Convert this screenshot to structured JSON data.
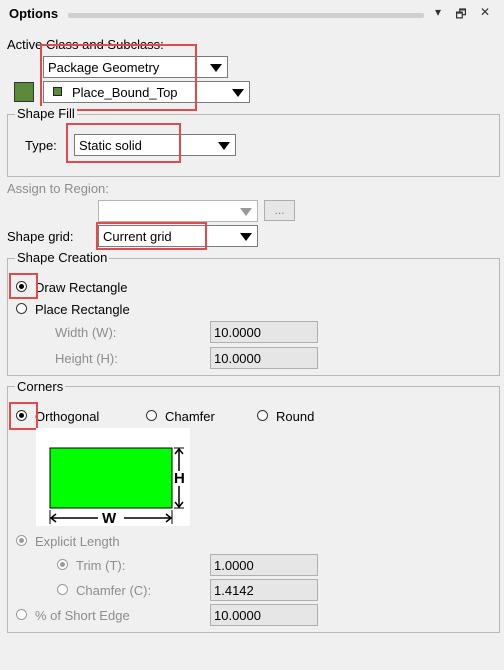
{
  "window": {
    "title": "Options",
    "controls": {
      "close": "✕",
      "restore": "🗗",
      "pin": "▾"
    }
  },
  "active_class": {
    "label": "Active Class and Subclass:",
    "class_value": "Package Geometry",
    "subclass_value": "Place_Bound_Top",
    "color_swatch": "#5b8a3a"
  },
  "shape_fill": {
    "group_title": "Shape Fill",
    "type_label": "Type:",
    "type_value": "Static solid"
  },
  "assign_region": {
    "label": "Assign to Region:",
    "value": "",
    "browse_label": "..."
  },
  "shape_grid": {
    "label": "Shape grid:",
    "value": "Current grid"
  },
  "shape_creation": {
    "group_title": "Shape Creation",
    "draw_rect": "Draw Rectangle",
    "place_rect": "Place Rectangle",
    "width_label": "Width (W):",
    "width_value": "10.0000",
    "height_label": "Height (H):",
    "height_value": "10.0000"
  },
  "corners": {
    "group_title": "Corners",
    "orthogonal": "Orthogonal",
    "chamfer": "Chamfer",
    "round": "Round",
    "diagram": {
      "fill_color": "#00ff00",
      "h_label": "H",
      "w_label": "W"
    },
    "explicit_length": "Explicit Length",
    "trim_label": "Trim (T):",
    "trim_value": "1.0000",
    "chamfer_label": "Chamfer (C):",
    "chamfer_value": "1.4142",
    "short_edge_label": "% of Short Edge",
    "short_edge_value": "10.0000"
  },
  "colors": {
    "highlight": "#e14b4b"
  }
}
